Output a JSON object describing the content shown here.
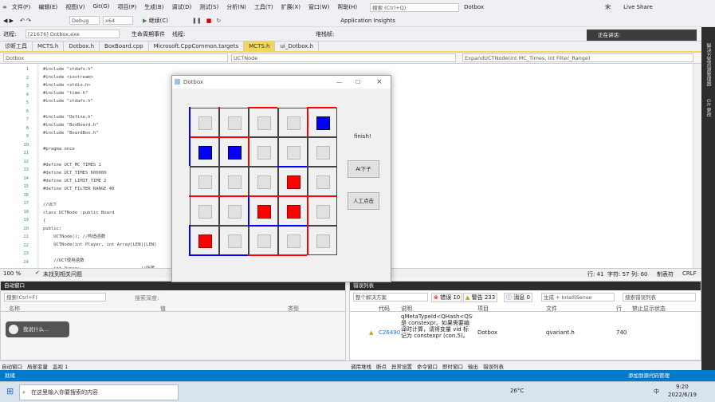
{
  "menu": [
    "文件(F)",
    "编辑(E)",
    "视图(V)",
    "Git(G)",
    "项目(P)",
    "生成(B)",
    "调试(D)",
    "测试(S)",
    "分析(N)",
    "工具(T)",
    "扩展(X)",
    "窗口(W)",
    "帮助(H)"
  ],
  "search_placeholder": "搜索 (Ctrl+Q)",
  "solution_name": "Dotbox",
  "user_initial": "宋",
  "live_share": "Live Share",
  "toolbar": {
    "config": "Debug",
    "platform": "x64",
    "continue": "继续(C)",
    "app_insights": "Application Insights",
    "process_label": "进程:",
    "process": "[21676] Dotbox.exe",
    "lifecycle": "生命周期事件",
    "thread": "线程:",
    "stack": "堆栈帧:"
  },
  "tabs": [
    "诊断工具",
    "MCTS.h",
    "Dotbox.h",
    "BoxBoard.cpp",
    "Microsoft.CppCommon.targets",
    "MCTS.h",
    "ui_Dotbox.h"
  ],
  "active_tab_index": 5,
  "nav": {
    "project": "Dotbox",
    "class": "UCTNode",
    "member": "ExpandUCTNode(int MC_Times, int Filter_Range)"
  },
  "line_numbers": [
    "1",
    "2",
    "3",
    "4",
    "5",
    "6",
    "7",
    "8",
    "9",
    "10",
    "11",
    "12",
    "13",
    "14",
    "15",
    "16",
    "17",
    "18",
    "19",
    "20",
    "21",
    "22",
    "23",
    "24"
  ],
  "code_lines": [
    "#include \"stdafx.h\"",
    "#include <iostream>",
    "#include <stdio.h>",
    "#include \"time.h\"",
    "#include \"stdafx.h\"",
    "",
    "#include \"Define.h\"",
    "#include \"BoxBoard.h\"",
    "#include \"BoardBox.h\"",
    "",
    "#pragma once",
    "",
    "#define UCT_MC_TIMES 1",
    "#define UCT_TIMES 600000",
    "#define UCT_LIMIT_TIME 2",
    "#define UCT_FILTER RANGE 40",
    "",
    "//UCT",
    "class UCTNode :public Board",
    "{",
    "public:",
    "    UCTNode(); //构造函数",
    "    UCTNode(int Player, int Array[LEN][LEN]",
    "",
    "    //UCT使用函数",
    "    int Owner;                       //所属"
  ],
  "status": {
    "zoom": "100 %",
    "issues": "未找到相关问题",
    "line": "行: 41",
    "char": "字符: 57",
    "col": "列: 60",
    "mode": "制表符",
    "eol": "CRLF"
  },
  "right_bar": [
    "解决方案资源管理器",
    "Git 更改"
  ],
  "dialog": {
    "title": "Dotbox",
    "finish": "finish!",
    "btn_ai": "AI下子",
    "btn_human": "人工点击",
    "cells": [
      [
        "empty",
        "empty",
        "empty",
        "empty",
        "blue"
      ],
      [
        "blue",
        "blue",
        "empty",
        "empty",
        "empty"
      ],
      [
        "empty",
        "empty",
        "empty",
        "red",
        "empty"
      ],
      [
        "empty",
        "empty",
        "red",
        "red",
        "empty"
      ],
      [
        "red",
        "empty",
        "empty",
        "empty",
        "empty"
      ]
    ]
  },
  "auto_window": {
    "title": "自动窗口",
    "search": "搜索(Ctrl+F)",
    "search_depth": "搜索深度:",
    "col_name": "名称",
    "col_value": "值",
    "col_type": "类型"
  },
  "chat_hint": "我说什么...",
  "error_list": {
    "title": "错误列表",
    "scope": "整个解决方案",
    "errors": "错误 10",
    "warnings": "警告 233",
    "messages": "消息 0",
    "build": "生成 + IntelliSense",
    "search": "搜索错误列表",
    "cols": [
      "代码",
      "说明",
      "项目",
      "文件",
      "行",
      "禁止显示状态"
    ],
    "row": {
      "code": "C26490",
      "desc": "qMetaTypeId<QHash<QString,QVariant>>: 是 constexpr。如果需要编译时计算，请将变量 vid 标记为 constexpr (con.5)。",
      "project": "Dotbox",
      "file": "qvariant.h",
      "line": "740"
    }
  },
  "bottom_tabs_left": [
    "自动窗口",
    "局部变量",
    "监视 1"
  ],
  "bottom_tabs_right": [
    "调用堆栈",
    "断点",
    "异常设置",
    "命令窗口",
    "即时窗口",
    "输出",
    "错误列表"
  ],
  "status_bar": {
    "left": "就绪",
    "right": "添加到源代码管理"
  },
  "taskbar": {
    "search": "在这里输入你要搜索的内容",
    "weather": "26°C",
    "time": "9:20",
    "date": "2022/6/19",
    "ime": "中"
  },
  "notify": "正在讲话:",
  "colors": {
    "red": "#ff0000",
    "blue": "#0000ff",
    "accent": "#007acc"
  }
}
